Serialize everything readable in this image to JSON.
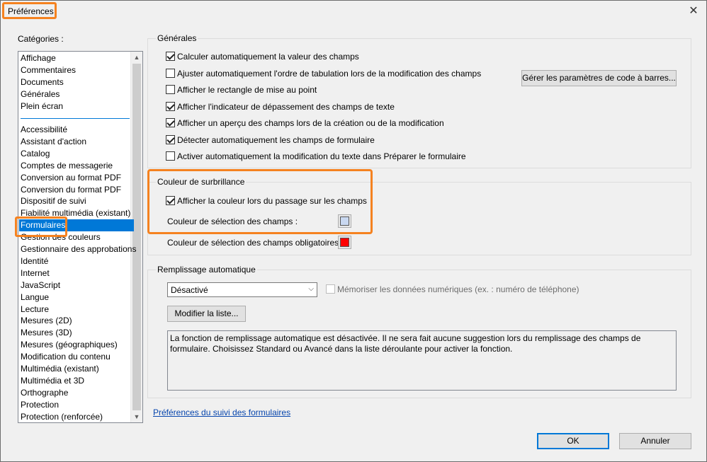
{
  "window": {
    "title": "Préférences",
    "close_glyph": "✕"
  },
  "categories": {
    "label": "Catégories :",
    "group1": [
      "Affichage",
      "Commentaires",
      "Documents",
      "Générales",
      "Plein écran"
    ],
    "group2": [
      "Accessibilité",
      "Assistant d'action",
      "Catalog",
      "Comptes de messagerie",
      "Conversion au format PDF",
      "Conversion du format PDF",
      "Dispositif de suivi",
      "Fiabilité multimédia (existant)",
      "Formulaires",
      "Gestion des couleurs",
      "Gestionnaire des approbations",
      "Identité",
      "Internet",
      "JavaScript",
      "Langue",
      "Lecture",
      "Mesures (2D)",
      "Mesures (3D)",
      "Mesures (géographiques)",
      "Modification du contenu",
      "Multimédia (existant)",
      "Multimédia et 3D",
      "Orthographe",
      "Protection",
      "Protection (renforcée)"
    ],
    "selected": "Formulaires"
  },
  "generales": {
    "title": "Générales",
    "options": [
      {
        "label": "Calculer automatiquement la valeur des champs",
        "checked": true
      },
      {
        "label": "Ajuster automatiquement l'ordre de tabulation lors de la modification des champs",
        "checked": false
      },
      {
        "label": "Afficher le rectangle de mise au point",
        "checked": false
      },
      {
        "label": "Afficher l'indicateur de dépassement des champs de texte",
        "checked": true
      },
      {
        "label": "Afficher un aperçu des champs lors de la création ou de la modification",
        "checked": true
      },
      {
        "label": "Détecter automatiquement les champs de formulaire",
        "checked": true
      },
      {
        "label": "Activer automatiquement la modification du texte dans Préparer le formulaire",
        "checked": false
      }
    ],
    "barcode_button": "Gérer les paramètres de code à barres..."
  },
  "surbrillance": {
    "title": "Couleur de surbrillance",
    "hover_option": {
      "label": "Afficher la couleur lors du passage sur les champs",
      "checked": true
    },
    "field_color_label": "Couleur de sélection des champs :",
    "field_color": "#c9d8f0",
    "required_color_label": "Couleur de sélection des champs obligatoires :",
    "required_color": "#ff0000"
  },
  "remplissage": {
    "title": "Remplissage automatique",
    "mode": "Désactivé",
    "memo_label": "Mémoriser les données numériques (ex. : numéro de téléphone)",
    "edit_button": "Modifier la liste...",
    "description": "La fonction de remplissage automatique est désactivée. Il ne sera fait aucune suggestion lors du remplissage des champs de formulaire. Choisissez Standard ou Avancé dans la liste déroulante pour activer la fonction."
  },
  "tracking_link": "Préférences du suivi des formulaires",
  "footer": {
    "ok": "OK",
    "cancel": "Annuler"
  },
  "colors": {
    "accent_highlight": "#f58220",
    "selection": "#0078d7"
  }
}
